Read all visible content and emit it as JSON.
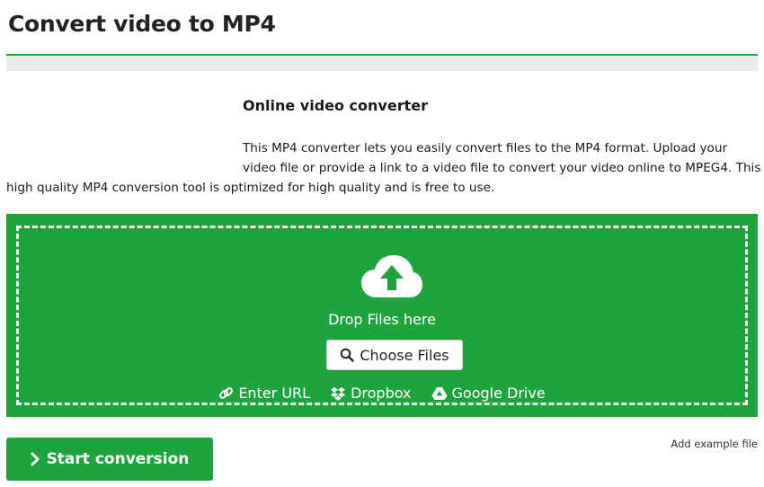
{
  "header": {
    "title": "Convert video to MP4"
  },
  "intro": {
    "heading": "Online video converter",
    "body": "This MP4 converter lets you easily convert files to the MP4 format. Upload your video file or provide a link to a video file to convert your video online to MPEG4. This high quality MP4 conversion tool is optimized for high quality and is free to use."
  },
  "dropzone": {
    "icon": "cloud-upload-icon",
    "drop_text": "Drop Files here",
    "choose_label": "Choose Files",
    "choose_icon": "search-icon",
    "sources": [
      {
        "label": "Enter URL",
        "icon": "link-icon"
      },
      {
        "label": "Dropbox",
        "icon": "dropbox-icon"
      },
      {
        "label": "Google Drive",
        "icon": "google-drive-icon"
      }
    ],
    "color": "#1fa33d"
  },
  "actions": {
    "start_label": "Start conversion",
    "start_icon": "chevron-right-icon",
    "example_label": "Add example file"
  },
  "colors": {
    "accent": "#1fa33d",
    "rule": "#22a844",
    "band": "#ebebeb"
  }
}
